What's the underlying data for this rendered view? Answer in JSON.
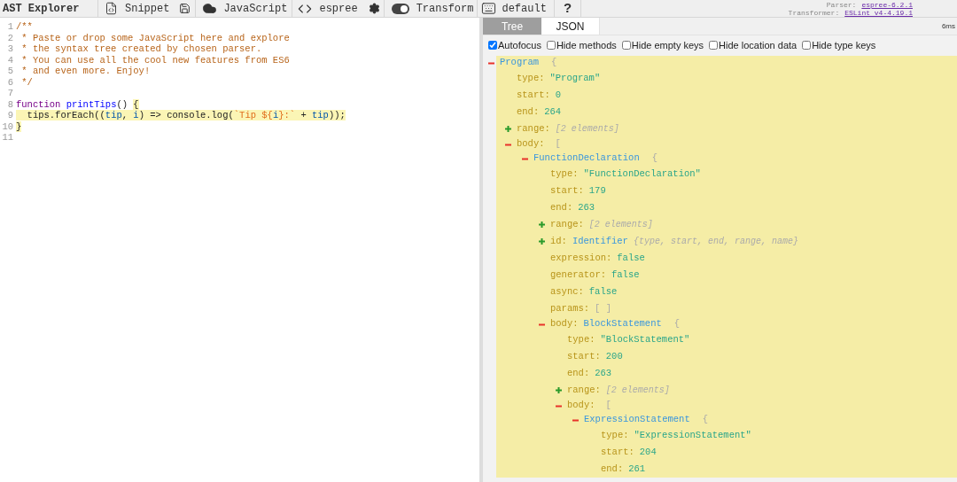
{
  "toolbar": {
    "title": "AST Explorer",
    "snippet": {
      "label": "Snippet"
    },
    "language": {
      "label": "JavaScript"
    },
    "parser": {
      "label": "espree"
    },
    "transform": {
      "label": "Transform",
      "on": true
    },
    "keymap": {
      "label": "default"
    },
    "help": {
      "label": "?"
    },
    "versions": [
      {
        "label": "Parser:",
        "link": "espree-6.2.1"
      },
      {
        "label": "Transformer:",
        "link": "ESLint v4-4.19.1"
      }
    ]
  },
  "editor": {
    "lines": [
      {
        "number": "1",
        "tokens": [
          {
            "text": "/**",
            "kind": "comment",
            "highlighted": false
          }
        ]
      },
      {
        "number": "2",
        "tokens": [
          {
            "text": " * Paste or drop some JavaScript here and explore",
            "kind": "comment",
            "highlighted": false
          }
        ]
      },
      {
        "number": "3",
        "tokens": [
          {
            "text": " * the syntax tree created by chosen parser.",
            "kind": "comment",
            "highlighted": false
          }
        ]
      },
      {
        "number": "4",
        "tokens": [
          {
            "text": " * You can use all the cool new features from ES6",
            "kind": "comment",
            "highlighted": false
          }
        ]
      },
      {
        "number": "5",
        "tokens": [
          {
            "text": " * and even more. Enjoy!",
            "kind": "comment",
            "highlighted": false
          }
        ]
      },
      {
        "number": "6",
        "tokens": [
          {
            "text": " */",
            "kind": "comment",
            "highlighted": false
          }
        ]
      },
      {
        "number": "7"
      },
      {
        "number": "8",
        "tokens": [
          {
            "text": "function ",
            "kind": "keyword",
            "highlighted": false
          },
          {
            "text": "printTips",
            "kind": "def",
            "highlighted": false
          },
          {
            "text": "() ",
            "kind": "plain",
            "highlighted": false
          },
          {
            "text": "{",
            "kind": "plain",
            "highlighted": true
          }
        ]
      },
      {
        "number": "9",
        "tokens": [
          {
            "text": "  tips.forEach((",
            "kind": "plain",
            "highlighted": true
          },
          {
            "text": "tip",
            "kind": "variable",
            "highlighted": true
          },
          {
            "text": ", ",
            "kind": "plain",
            "highlighted": true
          },
          {
            "text": "i",
            "kind": "variable",
            "highlighted": true
          },
          {
            "text": ") => console.log(",
            "kind": "plain",
            "highlighted": true
          },
          {
            "text": "`Tip ${",
            "kind": "string",
            "highlighted": true
          },
          {
            "text": "i",
            "kind": "variable",
            "highlighted": true
          },
          {
            "text": "}:`",
            "kind": "string",
            "highlighted": true
          },
          {
            "text": " + ",
            "kind": "plain",
            "highlighted": true
          },
          {
            "text": "tip",
            "kind": "variable",
            "highlighted": true
          },
          {
            "text": "));",
            "kind": "plain",
            "highlighted": true
          }
        ]
      },
      {
        "number": "10",
        "tokens": [
          {
            "text": "}",
            "kind": "plain",
            "highlighted": true
          }
        ]
      },
      {
        "number": "11"
      }
    ]
  },
  "output": {
    "tabs": [
      {
        "label": "Tree",
        "selected": true
      },
      {
        "label": "JSON",
        "selected": false
      }
    ],
    "time": "6ms",
    "options": [
      {
        "label": "Autofocus",
        "checked": true
      },
      {
        "label": "Hide methods",
        "checked": false
      },
      {
        "label": "Hide empty keys",
        "checked": false
      },
      {
        "label": "Hide location data",
        "checked": false
      },
      {
        "label": "Hide type keys",
        "checked": false
      }
    ],
    "tree": [
      {
        "kind": "node",
        "type_name": "Program",
        "open": "{",
        "expanded": true,
        "selected": true,
        "children": [
          {
            "kind": "value",
            "key": "type:",
            "value": "\"Program\""
          },
          {
            "kind": "value",
            "key": "start:",
            "value": "0"
          },
          {
            "kind": "value",
            "key": "end:",
            "value": "264"
          },
          {
            "kind": "array",
            "key": "range:",
            "summary": "[2 elements]",
            "expanded": false
          },
          {
            "kind": "array",
            "key": "body:",
            "open": "[",
            "expanded": true,
            "children": [
              {
                "kind": "node",
                "type_name": "FunctionDeclaration",
                "open": "{",
                "expanded": true,
                "children": [
                  {
                    "kind": "value",
                    "key": "type:",
                    "value": "\"FunctionDeclaration\""
                  },
                  {
                    "kind": "value",
                    "key": "start:",
                    "value": "179"
                  },
                  {
                    "kind": "value",
                    "key": "end:",
                    "value": "263"
                  },
                  {
                    "kind": "array",
                    "key": "range:",
                    "summary": "[2 elements]",
                    "expanded": false
                  },
                  {
                    "kind": "node",
                    "key": "id:",
                    "type_name": "Identifier",
                    "summary": "{type, start, end, range, name}",
                    "expanded": false
                  },
                  {
                    "kind": "value",
                    "key": "expression:",
                    "value": "false"
                  },
                  {
                    "kind": "value",
                    "key": "generator:",
                    "value": "false"
                  },
                  {
                    "kind": "value",
                    "key": "async:",
                    "value": "false"
                  },
                  {
                    "kind": "empty",
                    "key": "params:",
                    "value": "[ ]"
                  },
                  {
                    "kind": "node",
                    "key": "body:",
                    "type_name": "BlockStatement",
                    "open": "{",
                    "expanded": true,
                    "children": [
                      {
                        "kind": "value",
                        "key": "type:",
                        "value": "\"BlockStatement\""
                      },
                      {
                        "kind": "value",
                        "key": "start:",
                        "value": "200"
                      },
                      {
                        "kind": "value",
                        "key": "end:",
                        "value": "263"
                      },
                      {
                        "kind": "array",
                        "key": "range:",
                        "summary": "[2 elements]",
                        "expanded": false
                      },
                      {
                        "kind": "array",
                        "key": "body:",
                        "open": "[",
                        "expanded": true,
                        "children": [
                          {
                            "kind": "node",
                            "type_name": "ExpressionStatement",
                            "open": "{",
                            "expanded": true,
                            "children": [
                              {
                                "kind": "value",
                                "key": "type:",
                                "value": "\"ExpressionStatement\""
                              },
                              {
                                "kind": "value",
                                "key": "start:",
                                "value": "204"
                              },
                              {
                                "kind": "value",
                                "key": "end:",
                                "value": "261"
                              }
                            ]
                          }
                        ]
                      }
                    ]
                  }
                ]
              }
            ]
          }
        ]
      }
    ]
  }
}
